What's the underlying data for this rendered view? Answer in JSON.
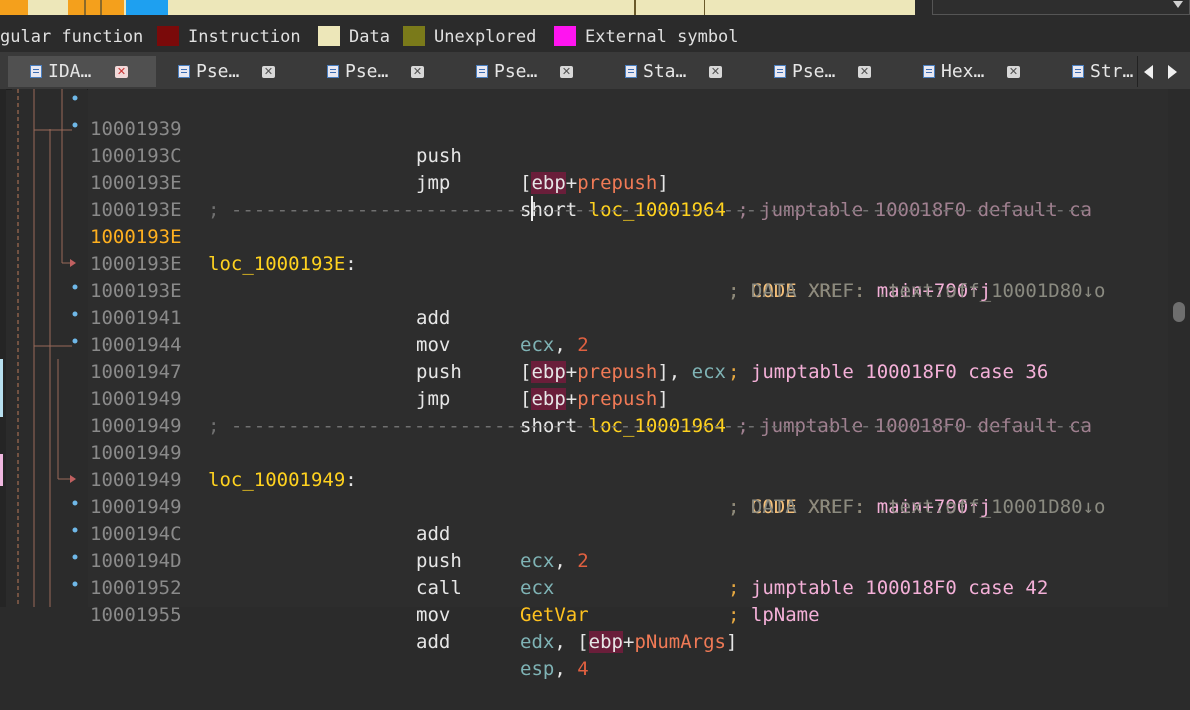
{
  "colors": {
    "background": "#2d2d2d",
    "address": "#8a8a8a",
    "address_highlight": "#ffb01f",
    "label": "#ffd21f",
    "register": "#7fb3b5",
    "number": "#e06040",
    "stack_var": "#f07a56",
    "comment": "#e6a840",
    "legend_instruction": "#7a0a0a",
    "legend_data": "#ede7b9",
    "legend_unexplored": "#7a7a1a",
    "legend_external": "#ff14f0"
  },
  "legend": {
    "regular_function": "gular function",
    "instruction": "Instruction",
    "data": "Data",
    "unexplored": "Unexplored",
    "external_symbol": "External symbol"
  },
  "tabs": [
    {
      "label": "IDA…",
      "icon": "ida-view-icon",
      "active": true
    },
    {
      "label": "Pse…",
      "icon": "pseudocode-icon"
    },
    {
      "label": "Pse…",
      "icon": "pseudocode-icon"
    },
    {
      "label": "Pse…",
      "icon": "pseudocode-icon"
    },
    {
      "label": "Sta…",
      "icon": "stack-view-icon"
    },
    {
      "label": "Pse…",
      "icon": "pseudocode-icon"
    },
    {
      "label": "Hex…",
      "icon": "hex-view-icon"
    },
    {
      "label": "Str…",
      "icon": "strings-view-icon"
    }
  ],
  "close_glyph": "✕",
  "lines": [
    {
      "addr": "10001939",
      "mnem": "push",
      "a1": "[",
      "ebp": "ebp",
      "a2": "+",
      "var": "prepush",
      "a3": "]"
    },
    {
      "addr": "1000193C",
      "mnem": "jmp",
      "kw": "short ",
      "loc": "loc_10001964",
      "cmt": " ; jumptable 100018F0 default ca"
    },
    {
      "addr": "1000193E",
      "sep": "; ---------------------------------------------------------------------------"
    },
    {
      "addr": "1000193E"
    },
    {
      "addr": "1000193E",
      "label": "loc_1000193E",
      "colon": ":",
      "xref_semi": "; ",
      "xref_kw": "CODE XREF: ",
      "xref_val": "main+790↑j"
    },
    {
      "addr": "1000193E",
      "dxref": "; DATA XREF: .text:off_10001D80↓o"
    },
    {
      "addr": "1000193E",
      "mnem": "add",
      "reg": "ecx",
      "comma": ", ",
      "num": "2",
      "jt_semi": "; ",
      "jt": "jumptable 100018F0 case 36"
    },
    {
      "addr": "10001941",
      "mnem": "mov",
      "a1": "[",
      "ebp": "ebp",
      "a2": "+",
      "var": "prepush",
      "a3": "], ",
      "reg2": "ecx"
    },
    {
      "addr": "10001944",
      "mnem": "push",
      "a1": "[",
      "ebp": "ebp",
      "a2": "+",
      "var": "prepush",
      "a3": "]"
    },
    {
      "addr": "10001947",
      "mnem": "jmp",
      "kw": "short ",
      "loc": "loc_10001964",
      "cmt": " ; jumptable 100018F0 default ca"
    },
    {
      "addr": "10001949",
      "sep": "; ---------------------------------------------------------------------------"
    },
    {
      "addr": "10001949"
    },
    {
      "addr": "10001949",
      "label": "loc_10001949",
      "colon": ":",
      "xref_semi": "; ",
      "xref_kw": "CODE XREF: ",
      "xref_val": "main+790↑j"
    },
    {
      "addr": "10001949",
      "dxref": "; DATA XREF: .text:off_10001D80↓o"
    },
    {
      "addr": "10001949",
      "mnem": "add",
      "reg": "ecx",
      "comma": ", ",
      "num": "2",
      "jt_semi": "; ",
      "jt": "jumptable 100018F0 case 42"
    },
    {
      "addr": "1000194C",
      "mnem": "push",
      "reg": "ecx",
      "jt_semi": "; ",
      "jt": "lpName"
    },
    {
      "addr": "1000194D",
      "mnem": "call",
      "fn": "GetVar"
    },
    {
      "addr": "10001952",
      "mnem": "mov",
      "reg": "edx",
      "comma": ", [",
      "ebp": "ebp",
      "a2": "+",
      "var": "pNumArgs",
      "a3": "]"
    },
    {
      "addr": "10001955",
      "mnem": "add",
      "reg": "esp",
      "comma": ", ",
      "num": "4"
    }
  ]
}
